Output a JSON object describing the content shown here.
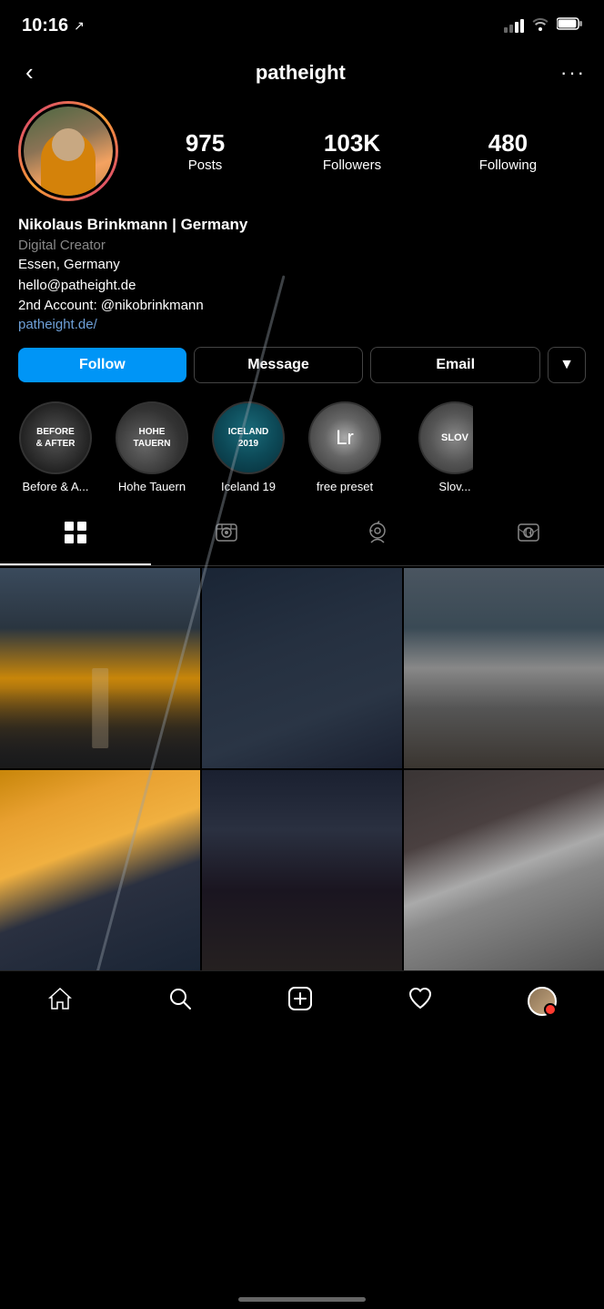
{
  "statusBar": {
    "time": "10:16",
    "locationArrow": "↗"
  },
  "header": {
    "backLabel": "‹",
    "username": "patheight",
    "moreLabel": "···"
  },
  "stats": {
    "posts": {
      "number": "975",
      "label": "Posts"
    },
    "followers": {
      "number": "103K",
      "label": "Followers"
    },
    "following": {
      "number": "480",
      "label": "Following"
    }
  },
  "bio": {
    "name": "Nikolaus Brinkmann | Germany",
    "category": "Digital Creator",
    "location": "Essen, Germany",
    "email": "hello@patheight.de",
    "secondAccount": "2nd Account: @nikobrinkmann",
    "website": "patheight.de/"
  },
  "buttons": {
    "follow": "Follow",
    "message": "Message",
    "email": "Email",
    "dropdown": "▼"
  },
  "highlights": [
    {
      "id": "before",
      "label": "Before & A...",
      "text": "BEFORE\n& AFTER"
    },
    {
      "id": "hohe",
      "label": "Hohe Tauern",
      "text": "HOHE\nTAUERN"
    },
    {
      "id": "iceland",
      "label": "Iceland 19",
      "text": "ICELAND\n2019"
    },
    {
      "id": "lr",
      "label": "free preset",
      "text": "Lr"
    },
    {
      "id": "slov",
      "label": "Slov...",
      "text": "SLOV"
    }
  ],
  "tabs": [
    {
      "id": "grid",
      "label": "Grid",
      "icon": "⊞",
      "active": true
    },
    {
      "id": "reels",
      "label": "Reels",
      "icon": "📺"
    },
    {
      "id": "tagged",
      "label": "Tagged",
      "icon": "☺"
    },
    {
      "id": "mentions",
      "label": "Mentions",
      "icon": "👤"
    }
  ],
  "photos": [
    {
      "id": 1,
      "class": "photo-1"
    },
    {
      "id": 2,
      "class": "photo-2"
    },
    {
      "id": 3,
      "class": "photo-3"
    },
    {
      "id": 4,
      "class": "photo-4"
    },
    {
      "id": 5,
      "class": "photo-5"
    },
    {
      "id": 6,
      "class": "photo-6"
    }
  ],
  "bottomNav": {
    "home": "⌂",
    "search": "🔍",
    "add": "⊞",
    "likes": "♡",
    "profile": "avatar"
  }
}
